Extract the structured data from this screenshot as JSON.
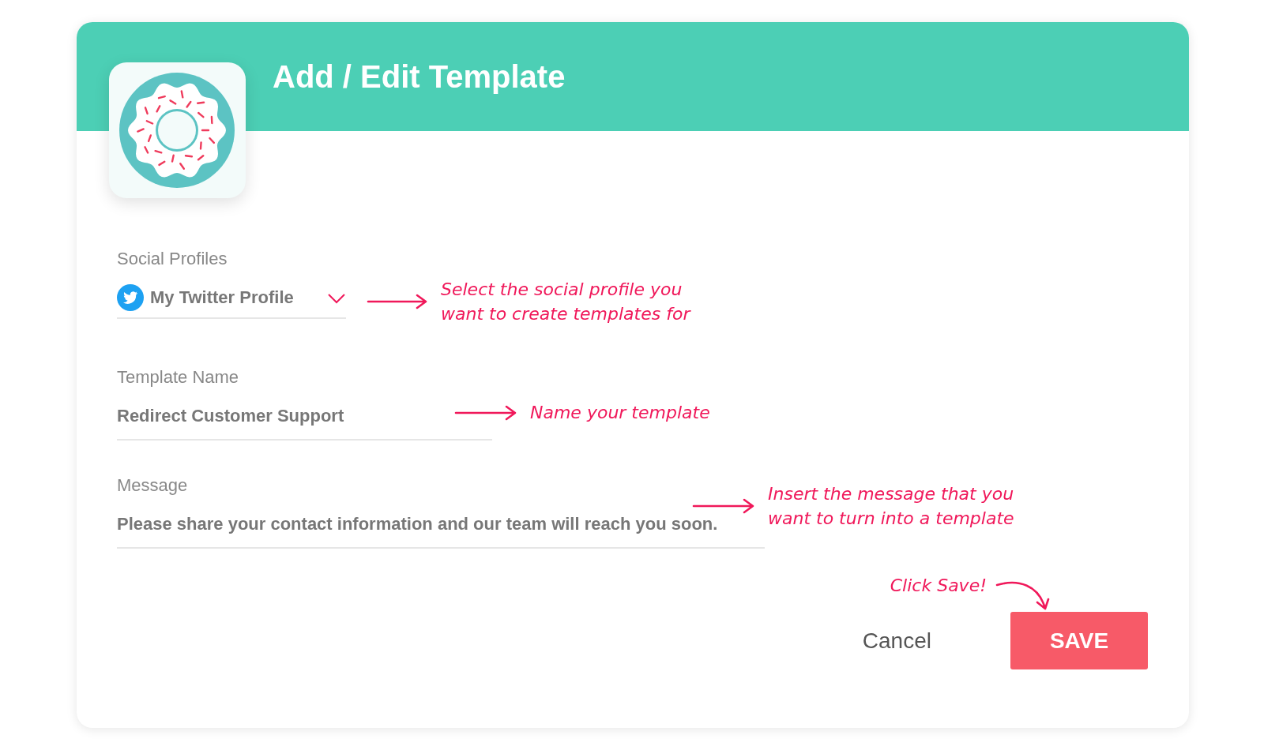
{
  "dialog": {
    "title": "Add / Edit Template"
  },
  "fields": [
    {
      "kind": "select",
      "label": "Social Profiles",
      "value": "My Twitter Profile",
      "annotation": "Select the social profile you\nwant to create templates for"
    },
    {
      "kind": "text",
      "label": "Template Name",
      "value": "Redirect Customer Support",
      "annotation": "Name your template"
    },
    {
      "kind": "textarea",
      "label": "Message",
      "value": "Please share your contact information and our team will reach you soon.",
      "annotation": "Insert the message that you\nwant to turn into a template"
    }
  ],
  "save_annotation": "Click Save!",
  "buttons": [
    {
      "kind": "secondary",
      "label": "Cancel"
    },
    {
      "kind": "primary",
      "label": "SAVE"
    }
  ]
}
